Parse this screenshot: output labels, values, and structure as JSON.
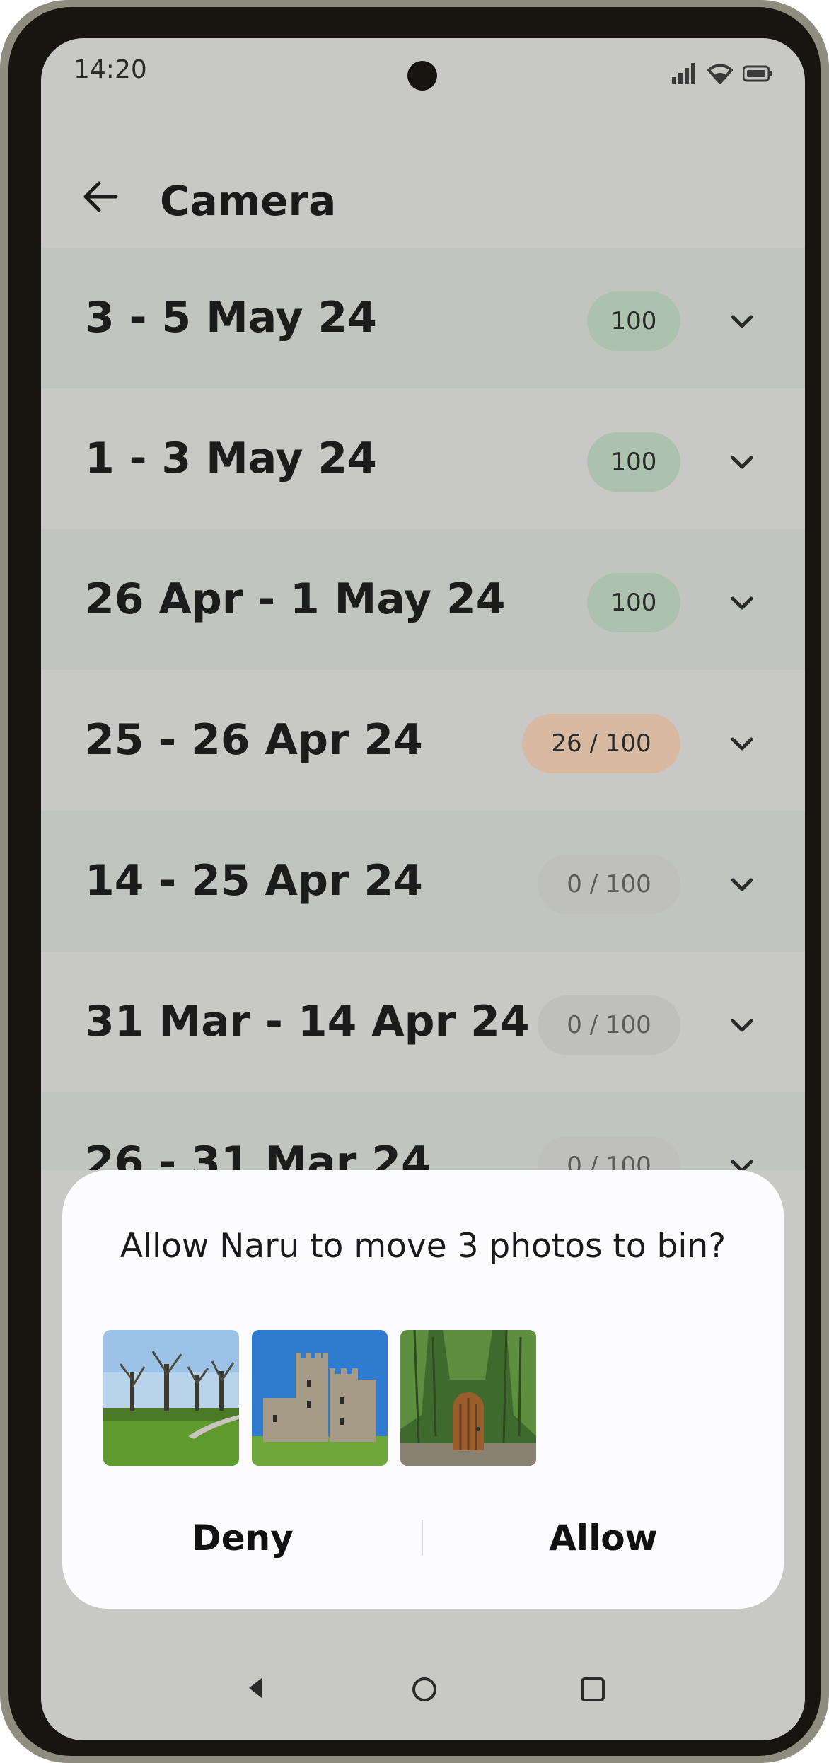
{
  "status_bar": {
    "time": "14:20",
    "icons": [
      "signal-icon",
      "wifi-icon",
      "battery-icon"
    ]
  },
  "app_bar": {
    "back_icon": "arrow-left-icon",
    "title": "Camera"
  },
  "date_groups": [
    {
      "label": "3 - 5 May 24",
      "badge": "100",
      "status": "complete"
    },
    {
      "label": "1 - 3 May 24",
      "badge": "100",
      "status": "complete"
    },
    {
      "label": "26 Apr - 1 May 24",
      "badge": "100",
      "status": "complete"
    },
    {
      "label": "25 - 26 Apr 24",
      "badge": "26 / 100",
      "status": "partial"
    },
    {
      "label": "14 - 25 Apr 24",
      "badge": "0 / 100",
      "status": "none"
    },
    {
      "label": "31 Mar - 14 Apr 24",
      "badge": "0 / 100",
      "status": "none"
    },
    {
      "label": "26 - 31 Mar 24",
      "badge": "0 / 100",
      "status": "none"
    }
  ],
  "dialog": {
    "question": "Allow Naru to move 3 photos to bin?",
    "thumbnails": [
      "park-trees-photo",
      "castle-photo",
      "wooden-door-photo"
    ],
    "deny_label": "Deny",
    "allow_label": "Allow"
  },
  "colors": {
    "badge_complete": "#adc2ae",
    "badge_partial": "#d8b9a2",
    "badge_none": "#bfbfbd"
  },
  "nav_bar": {
    "icons": [
      "nav-back-icon",
      "nav-home-icon",
      "nav-recents-icon"
    ]
  }
}
